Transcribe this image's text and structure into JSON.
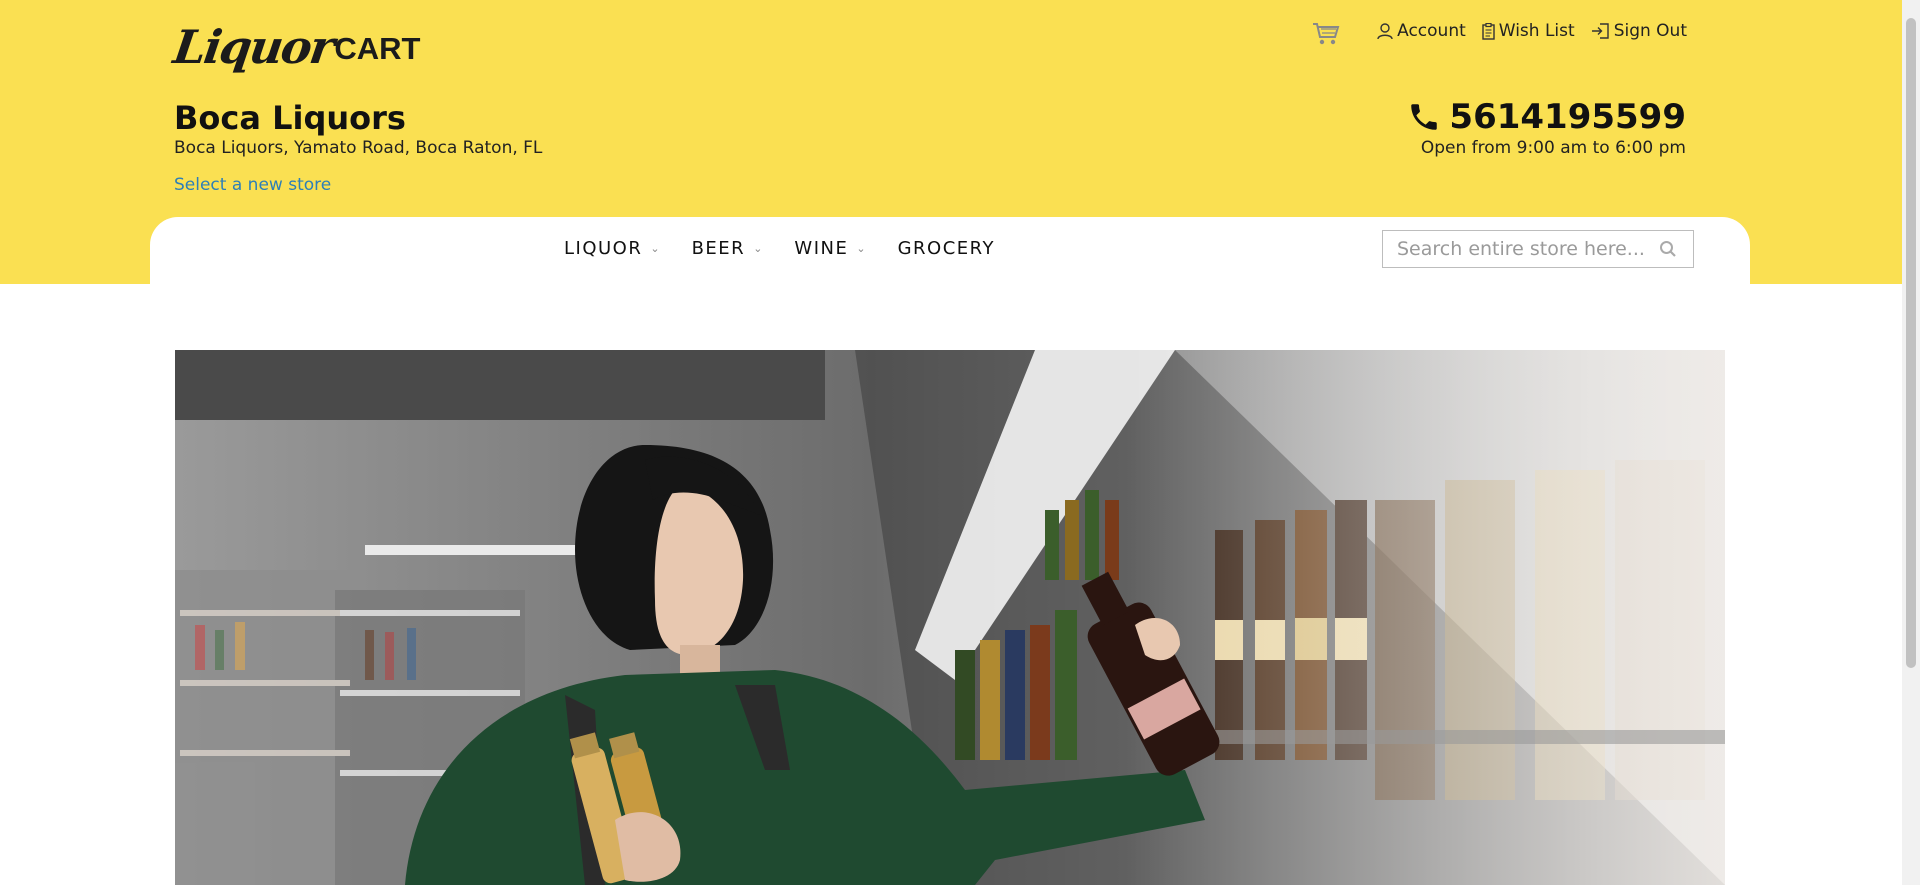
{
  "brand": {
    "script": "Liquor",
    "block": "CART"
  },
  "toplinks": {
    "account": "Account",
    "wishlist": "Wish List",
    "signout": "Sign Out"
  },
  "store": {
    "name": "Boca Liquors",
    "address": "Boca Liquors, Yamato Road, Boca Raton, FL",
    "select_link": "Select a new store",
    "phone": "5614195599",
    "hours": "Open from 9:00 am to 6:00 pm"
  },
  "nav": [
    {
      "label": "LIQUOR",
      "dropdown": true
    },
    {
      "label": "BEER",
      "dropdown": true
    },
    {
      "label": "WINE",
      "dropdown": true
    },
    {
      "label": "GROCERY",
      "dropdown": false
    }
  ],
  "search": {
    "placeholder": "Search entire store here..."
  },
  "icons": [
    "cart-icon",
    "user-icon",
    "clipboard-icon",
    "sign-out-icon",
    "phone-icon",
    "search-icon",
    "chevron-down-icon"
  ],
  "colors": {
    "header_bg": "#fae052",
    "link": "#2d7fb8",
    "text": "#111111"
  }
}
